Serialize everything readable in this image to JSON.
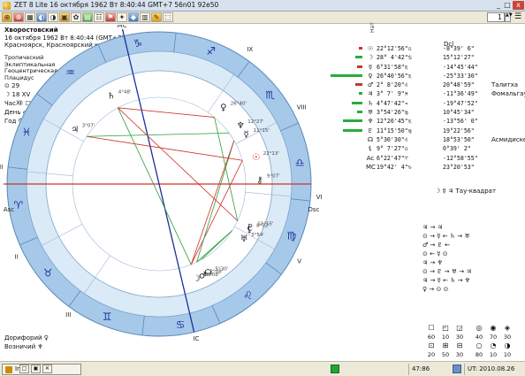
{
  "window": {
    "title": "ZET 8 Lite    16 октября 1962  Вт   8:40:44 GMT+7 56n01  92e50",
    "minimize_glyph": "_",
    "maximize_glyph": "□",
    "close_glyph": "x"
  },
  "toolbar": {
    "buttons": [
      "⊕",
      "⊗",
      "▦",
      "◐",
      "◑",
      "▣",
      "✿",
      "▤",
      "☷",
      "⚑",
      "✦",
      "◆",
      "▥",
      "✎",
      "⬚"
    ],
    "spin_value": "1",
    "spin_arrows": "▲▼",
    "menu_glyph": "☰"
  },
  "chart_info": {
    "name": "Хворостовский",
    "datetime": "16 октября 1962  Вт   8:40:44 (GMT+7) 56n01  92e50",
    "place": "Красноярск, Красноярский край, Россия",
    "zodiac": "Тропический",
    "coordinates": "Эклиптикальная",
    "center": "Геоцентрическая",
    "houses": "Плацидус"
  },
  "rulers": [
    {
      "glyph": "⊙",
      "text": "29"
    },
    {
      "glyph": "☽",
      "text": "18 XV"
    },
    {
      "glyph": "",
      "text": "Час ☉ ☐"
    },
    {
      "glyph": "",
      "text": "День ♂"
    },
    {
      "glyph": "",
      "text": "Год ♀"
    }
  ],
  "wheel": {
    "signs": [
      "♈",
      "♉",
      "♊",
      "♋",
      "♌",
      "♍",
      "♎",
      "♏",
      "♐",
      "♑",
      "♒",
      "♓"
    ],
    "house_labels": [
      "Asc",
      "II",
      "III",
      "IC",
      "V",
      "VI",
      "Dsc",
      "VIII",
      "IX",
      "MC",
      "XI",
      "XII"
    ],
    "planet_labels": [
      {
        "glyph": "☉",
        "deg": "22°13'"
      },
      {
        "glyph": "☽",
        "deg": "28°08'"
      },
      {
        "glyph": "☿",
        "deg": "11°15'"
      },
      {
        "glyph": "♀",
        "deg": "26°40'"
      },
      {
        "glyph": "♂",
        "deg": "2°08'"
      },
      {
        "glyph": "♃",
        "deg": "3°07'"
      },
      {
        "glyph": "♄",
        "deg": "4°48'"
      },
      {
        "glyph": "♅",
        "deg": "3°54'"
      },
      {
        "glyph": "♆",
        "deg": "12°27'"
      },
      {
        "glyph": "♇",
        "deg": "11°15'"
      },
      {
        "glyph": "☊",
        "deg": "5°30'"
      },
      {
        "glyph": "⚷",
        "deg": "9°07'"
      },
      {
        "glyph": "⚸",
        "deg": "8°32'"
      }
    ]
  },
  "table": {
    "header_nat": "Нат",
    "header_dcl": "Dcl",
    "rows": [
      {
        "glyph": "☉",
        "pos": "22°12'56\"♎",
        "decl": "-8°39' 6\"",
        "star": "",
        "bar_color": "#c0392b",
        "bar_w": 4
      },
      {
        "glyph": "☽",
        "pos": "28° 4'42\"♋",
        "decl": "15°12'27\"",
        "star": "",
        "bar_color": "#27ae3b",
        "bar_w": 8
      },
      {
        "glyph": "☿",
        "pos": "6°31'58\"♏",
        "decl": "-14°45'44\"",
        "star": "",
        "bar_color": "#c0392b",
        "bar_w": 6
      },
      {
        "glyph": "♀",
        "pos": "26°40'56\"♏",
        "decl": "-25°33'30\"",
        "star": "",
        "bar_color": "#27ae3b",
        "bar_w": 36
      },
      {
        "glyph": "♂",
        "pos": "2° 8'20\"♌",
        "decl": "20°48'59\"",
        "star": "Талитха",
        "bar_color": "#c0392b",
        "bar_w": 8
      },
      {
        "glyph": "♃",
        "pos": "3° 7' 9\"♓",
        "decl": "-11°36'49\"",
        "star": "Фомальгаут",
        "bar_color": "#27ae3b",
        "bar_w": 4
      },
      {
        "glyph": "♄",
        "pos": "4°47'42\"♒",
        "decl": "-19°47'52\"",
        "star": "",
        "bar_color": "#27ae3b",
        "bar_w": 12
      },
      {
        "glyph": "♅",
        "pos": "3°54'26\"♍",
        "decl": "10°45'34\"",
        "star": "",
        "bar_color": "#27ae3b",
        "bar_w": 6
      },
      {
        "glyph": "♆",
        "pos": "12°26'45\"♏",
        "decl": "-13°56' 0\"",
        "star": "",
        "bar_color": "#27ae3b",
        "bar_w": 22
      },
      {
        "glyph": "♇",
        "pos": "11°15'50\"♍",
        "decl": "19°22'56\"",
        "star": "",
        "bar_color": "#27ae3b",
        "bar_w": 22
      },
      {
        "glyph": "☊",
        "pos": "5°30'30\"♌",
        "decl": "18°53'50\"",
        "star": "Асмидиске",
        "bar_color": "",
        "bar_w": 0
      },
      {
        "glyph": "⚸",
        "pos": "9° 7'27\"♎",
        "decl": "0°39' 2\"",
        "star": "",
        "bar_color": "",
        "bar_w": 0
      },
      {
        "glyph": "Ac",
        "pos": "6°22'47\"♈",
        "decl": "-12°58'55\"",
        "star": "",
        "bar_color": "",
        "bar_w": 0
      },
      {
        "glyph": "MC",
        "pos": "19°42' 4\"♑",
        "decl": "23°20'53\"",
        "star": "",
        "bar_color": "",
        "bar_w": 0
      }
    ]
  },
  "aspect_note": "☽ ☿ ♃  Тау-квадрат",
  "aspect_lines": [
    "♃ → ♃",
    "⊙ → ☿ ← ♄ → ♅",
    "♂ → ♇ ←",
    "⊙ ← ☿ ⊙",
    "♃ → ♆",
    "⊙ → ♇ → ♅ → ♃",
    "♃ → ☿ ← ♄ → ♆",
    "♀ → ⊙ ⊙"
  ],
  "elements_grid": {
    "icons_row1": [
      "☐",
      "◰",
      "◲",
      "◎",
      "◉",
      "◈"
    ],
    "nums_row1": [
      "60",
      "10",
      "30",
      "40",
      "70",
      "30"
    ],
    "icons_row2": [
      "⊡",
      "⊞",
      "⊟",
      "○",
      "◔",
      "◑"
    ],
    "nums_row2": [
      "20",
      "50",
      "30",
      "80",
      "10",
      "10"
    ]
  },
  "bottom_left": [
    {
      "label": "Дорифорий",
      "glyph": "♀"
    },
    {
      "label": "Возничий",
      "glyph": "♆"
    }
  ],
  "taskbar": {
    "app_label": "In...",
    "mini_buttons": [
      "□",
      "▣",
      "✕"
    ],
    "coord": "47:86",
    "ut": "UT: 2010.08.26 21:09:23"
  },
  "colors": {
    "wheel_outer": "#a6c9ea",
    "wheel_ring": "#dbeaf7",
    "accent_red": "#d0302a",
    "accent_green": "#2e9c3a",
    "accent_blue": "#1c2f9a"
  }
}
